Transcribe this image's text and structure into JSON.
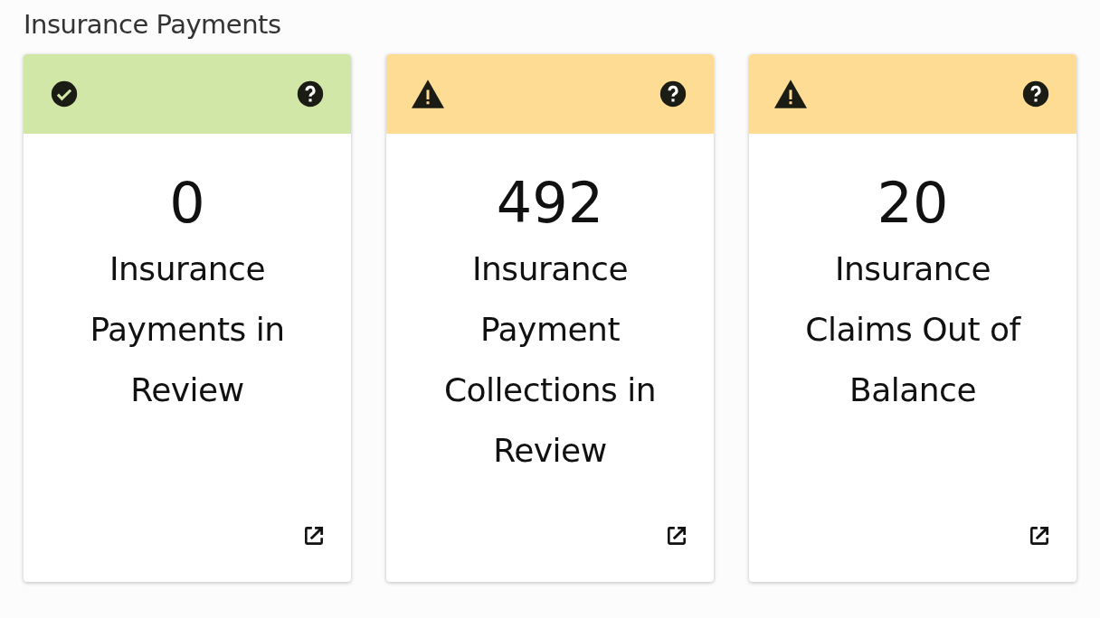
{
  "title": "Insurance Payments",
  "cards": [
    {
      "kind": "ok",
      "count": "0",
      "label": "Insurance Payments in Review"
    },
    {
      "kind": "warning",
      "count": "492",
      "label": "Insurance Payment Collections in Review"
    },
    {
      "kind": "warning",
      "count": "20",
      "label": "Insurance Claims Out of Balance"
    }
  ]
}
